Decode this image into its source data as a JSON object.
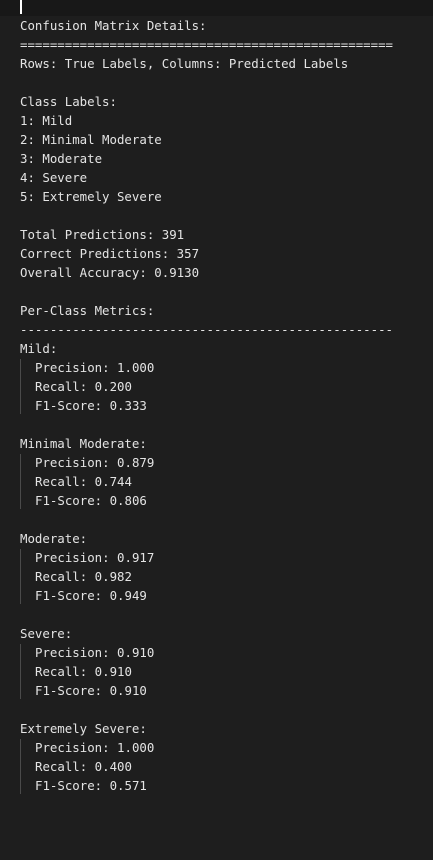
{
  "header": {
    "title": "Confusion Matrix Details:",
    "rule_double": "==================================================",
    "subtitle": "Rows: True Labels, Columns: Predicted Labels"
  },
  "class_labels": {
    "heading": "Class Labels:",
    "items": [
      "1: Mild",
      "2: Minimal Moderate",
      "3: Moderate",
      "4: Severe",
      "5: Extremely Severe"
    ]
  },
  "summary": {
    "total": "Total Predictions: 391",
    "correct": "Correct Predictions: 357",
    "accuracy": "Overall Accuracy: 0.9130"
  },
  "per_class": {
    "heading": "Per-Class Metrics:",
    "rule_single": "--------------------------------------------------",
    "classes": [
      {
        "name": "Mild:",
        "precision": "Precision: 1.000",
        "recall": "Recall: 0.200",
        "f1": "F1-Score: 0.333"
      },
      {
        "name": "Minimal Moderate:",
        "precision": "Precision: 0.879",
        "recall": "Recall: 0.744",
        "f1": "F1-Score: 0.806"
      },
      {
        "name": "Moderate:",
        "precision": "Precision: 0.917",
        "recall": "Recall: 0.982",
        "f1": "F1-Score: 0.949"
      },
      {
        "name": "Severe:",
        "precision": "Precision: 0.910",
        "recall": "Recall: 0.910",
        "f1": "F1-Score: 0.910"
      },
      {
        "name": "Extremely Severe:",
        "precision": "Precision: 1.000",
        "recall": "Recall: 0.400",
        "f1": "F1-Score: 0.571"
      }
    ]
  }
}
